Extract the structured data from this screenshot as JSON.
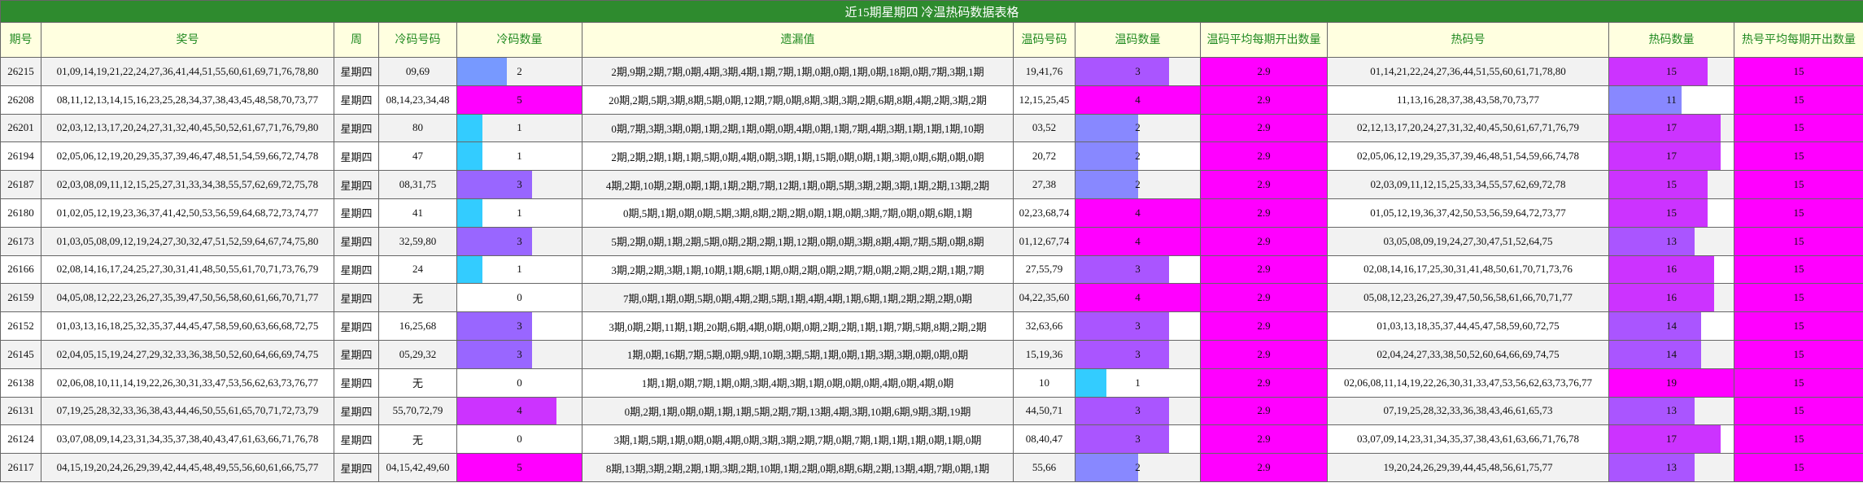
{
  "title": "近15期星期四 冷温热码数据表格",
  "headers": [
    "期号",
    "奖号",
    "周",
    "冷码号码",
    "冷码数量",
    "遗漏值",
    "温码号码",
    "温码数量",
    "温码平均每期开出数量",
    "热码号",
    "热码数量",
    "热号平均每期开出数量"
  ],
  "colors": {
    "title_bg": "#2e8b2e",
    "header_bg": "#ffffe0",
    "header_text": "#228b22",
    "accent": "#ff00ff"
  },
  "rows": [
    {
      "issue": "26215",
      "numbers": "01,09,14,19,21,22,24,27,36,41,44,51,55,60,61,69,71,76,78,80",
      "week": "星期四",
      "cold": "09,69",
      "cold_count": "2",
      "miss": "2期,9期,2期,7期,0期,4期,3期,4期,1期,7期,1期,0期,0期,1期,0期,18期,0期,7期,3期,1期",
      "warm": "19,41,76",
      "warm_count": "3",
      "warm_avg": "2.9",
      "hot": "01,14,21,22,24,27,36,44,51,55,60,61,71,78,80",
      "hot_count": "15",
      "hot_avg": "15"
    },
    {
      "issue": "26208",
      "numbers": "08,11,12,13,14,15,16,23,25,28,34,37,38,43,45,48,58,70,73,77",
      "week": "星期四",
      "cold": "08,14,23,34,48",
      "cold_count": "5",
      "miss": "20期,2期,5期,3期,8期,5期,0期,12期,7期,0期,8期,3期,3期,2期,6期,8期,4期,2期,3期,2期",
      "warm": "12,15,25,45",
      "warm_count": "4",
      "warm_avg": "2.9",
      "hot": "11,13,16,28,37,38,43,58,70,73,77",
      "hot_count": "11",
      "hot_avg": "15"
    },
    {
      "issue": "26201",
      "numbers": "02,03,12,13,17,20,24,27,31,32,40,45,50,52,61,67,71,76,79,80",
      "week": "星期四",
      "cold": "80",
      "cold_count": "1",
      "miss": "0期,7期,3期,3期,0期,1期,2期,1期,0期,0期,4期,0期,1期,7期,4期,3期,1期,1期,1期,10期",
      "warm": "03,52",
      "warm_count": "2",
      "warm_avg": "2.9",
      "hot": "02,12,13,17,20,24,27,31,32,40,45,50,61,67,71,76,79",
      "hot_count": "17",
      "hot_avg": "15"
    },
    {
      "issue": "26194",
      "numbers": "02,05,06,12,19,20,29,35,37,39,46,47,48,51,54,59,66,72,74,78",
      "week": "星期四",
      "cold": "47",
      "cold_count": "1",
      "miss": "2期,2期,2期,1期,1期,5期,0期,4期,0期,3期,1期,15期,0期,0期,1期,3期,0期,6期,0期,0期",
      "warm": "20,72",
      "warm_count": "2",
      "warm_avg": "2.9",
      "hot": "02,05,06,12,19,29,35,37,39,46,48,51,54,59,66,74,78",
      "hot_count": "17",
      "hot_avg": "15"
    },
    {
      "issue": "26187",
      "numbers": "02,03,08,09,11,12,15,25,27,31,33,34,38,55,57,62,69,72,75,78",
      "week": "星期四",
      "cold": "08,31,75",
      "cold_count": "3",
      "miss": "4期,2期,10期,2期,0期,1期,1期,2期,7期,12期,1期,0期,5期,3期,2期,3期,1期,2期,13期,2期",
      "warm": "27,38",
      "warm_count": "2",
      "warm_avg": "2.9",
      "hot": "02,03,09,11,12,15,25,33,34,55,57,62,69,72,78",
      "hot_count": "15",
      "hot_avg": "15"
    },
    {
      "issue": "26180",
      "numbers": "01,02,05,12,19,23,36,37,41,42,50,53,56,59,64,68,72,73,74,77",
      "week": "星期四",
      "cold": "41",
      "cold_count": "1",
      "miss": "0期,5期,1期,0期,0期,5期,3期,8期,2期,2期,0期,1期,0期,3期,7期,0期,0期,6期,1期",
      "warm": "02,23,68,74",
      "warm_count": "4",
      "warm_avg": "2.9",
      "hot": "01,05,12,19,36,37,42,50,53,56,59,64,72,73,77",
      "hot_count": "15",
      "hot_avg": "15"
    },
    {
      "issue": "26173",
      "numbers": "01,03,05,08,09,12,19,24,27,30,32,47,51,52,59,64,67,74,75,80",
      "week": "星期四",
      "cold": "32,59,80",
      "cold_count": "3",
      "miss": "5期,2期,0期,1期,2期,5期,0期,2期,2期,1期,12期,0期,0期,3期,8期,4期,7期,5期,0期,8期",
      "warm": "01,12,67,74",
      "warm_count": "4",
      "warm_avg": "2.9",
      "hot": "03,05,08,09,19,24,27,30,47,51,52,64,75",
      "hot_count": "13",
      "hot_avg": "15"
    },
    {
      "issue": "26166",
      "numbers": "02,08,14,16,17,24,25,27,30,31,41,48,50,55,61,70,71,73,76,79",
      "week": "星期四",
      "cold": "24",
      "cold_count": "1",
      "miss": "3期,2期,2期,3期,1期,10期,1期,6期,1期,0期,2期,0期,2期,7期,0期,2期,2期,2期,1期,7期",
      "warm": "27,55,79",
      "warm_count": "3",
      "warm_avg": "2.9",
      "hot": "02,08,14,16,17,25,30,31,41,48,50,61,70,71,73,76",
      "hot_count": "16",
      "hot_avg": "15"
    },
    {
      "issue": "26159",
      "numbers": "04,05,08,12,22,23,26,27,35,39,47,50,56,58,60,61,66,70,71,77",
      "week": "星期四",
      "cold": "无",
      "cold_count": "0",
      "miss": "7期,0期,1期,0期,5期,0期,4期,2期,5期,1期,4期,4期,1期,6期,1期,2期,2期,2期,0期",
      "warm": "04,22,35,60",
      "warm_count": "4",
      "warm_avg": "2.9",
      "hot": "05,08,12,23,26,27,39,47,50,56,58,61,66,70,71,77",
      "hot_count": "16",
      "hot_avg": "15"
    },
    {
      "issue": "26152",
      "numbers": "01,03,13,16,18,25,32,35,37,44,45,47,58,59,60,63,66,68,72,75",
      "week": "星期四",
      "cold": "16,25,68",
      "cold_count": "3",
      "miss": "3期,0期,2期,11期,1期,20期,6期,4期,0期,0期,0期,2期,2期,1期,1期,7期,5期,8期,2期,2期",
      "warm": "32,63,66",
      "warm_count": "3",
      "warm_avg": "2.9",
      "hot": "01,03,13,18,35,37,44,45,47,58,59,60,72,75",
      "hot_count": "14",
      "hot_avg": "15"
    },
    {
      "issue": "26145",
      "numbers": "02,04,05,15,19,24,27,29,32,33,36,38,50,52,60,64,66,69,74,75",
      "week": "星期四",
      "cold": "05,29,32",
      "cold_count": "3",
      "miss": "1期,0期,16期,7期,5期,0期,9期,10期,3期,5期,1期,0期,1期,3期,3期,0期,0期,0期",
      "warm": "15,19,36",
      "warm_count": "3",
      "warm_avg": "2.9",
      "hot": "02,04,24,27,33,38,50,52,60,64,66,69,74,75",
      "hot_count": "14",
      "hot_avg": "15"
    },
    {
      "issue": "26138",
      "numbers": "02,06,08,10,11,14,19,22,26,30,31,33,47,53,56,62,63,73,76,77",
      "week": "星期四",
      "cold": "无",
      "cold_count": "0",
      "miss": "1期,1期,0期,7期,1期,0期,3期,4期,3期,1期,0期,0期,0期,4期,0期,4期,0期",
      "warm": "10",
      "warm_count": "1",
      "warm_avg": "2.9",
      "hot": "02,06,08,11,14,19,22,26,30,31,33,47,53,56,62,63,73,76,77",
      "hot_count": "19",
      "hot_avg": "15"
    },
    {
      "issue": "26131",
      "numbers": "07,19,25,28,32,33,36,38,43,44,46,50,55,61,65,70,71,72,73,79",
      "week": "星期四",
      "cold": "55,70,72,79",
      "cold_count": "4",
      "miss": "0期,2期,1期,0期,0期,1期,1期,5期,2期,7期,13期,4期,3期,10期,6期,9期,3期,19期",
      "warm": "44,50,71",
      "warm_count": "3",
      "warm_avg": "2.9",
      "hot": "07,19,25,28,32,33,36,38,43,46,61,65,73",
      "hot_count": "13",
      "hot_avg": "15"
    },
    {
      "issue": "26124",
      "numbers": "03,07,08,09,14,23,31,34,35,37,38,40,43,47,61,63,66,71,76,78",
      "week": "星期四",
      "cold": "无",
      "cold_count": "0",
      "miss": "3期,1期,5期,1期,0期,0期,4期,0期,3期,3期,2期,7期,0期,7期,1期,1期,1期,0期,1期,0期",
      "warm": "08,40,47",
      "warm_count": "3",
      "warm_avg": "2.9",
      "hot": "03,07,09,14,23,31,34,35,37,38,43,61,63,66,71,76,78",
      "hot_count": "17",
      "hot_avg": "15"
    },
    {
      "issue": "26117",
      "numbers": "04,15,19,20,24,26,29,39,42,44,45,48,49,55,56,60,61,66,75,77",
      "week": "星期四",
      "cold": "04,15,42,49,60",
      "cold_count": "5",
      "miss": "8期,13期,3期,2期,2期,1期,3期,2期,10期,1期,2期,0期,8期,6期,2期,13期,4期,7期,0期,1期",
      "warm": "55,66",
      "warm_count": "2",
      "warm_avg": "2.9",
      "hot": "19,20,24,26,29,39,44,45,48,56,61,75,77",
      "hot_count": "13",
      "hot_avg": "15"
    }
  ]
}
